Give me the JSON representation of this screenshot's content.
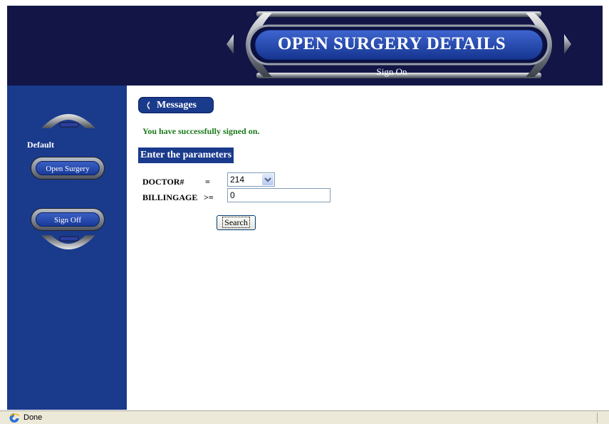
{
  "header": {
    "title": "OPEN SURGERY DETAILS",
    "subtitle": "Sign On"
  },
  "sidebar": {
    "section_label": "Default",
    "open_surgery_label": "Open Surgery",
    "sign_off_label": "Sign Off"
  },
  "messages": {
    "tab_label": "Messages",
    "success_text": "You have successfully signed on."
  },
  "form": {
    "heading": "Enter the parameters",
    "doctor_label": "DOCTOR#",
    "doctor_operator": "=",
    "doctor_value": "214",
    "billingage_label": "BILLINGAGE",
    "billingage_operator": ">=",
    "billingage_value": "0",
    "search_label": "Search"
  },
  "statusbar": {
    "text": "Done"
  },
  "colors": {
    "header_bg": "#121545",
    "sidebar_bg": "#1a3a8c",
    "success_green": "#1a7a1a"
  }
}
